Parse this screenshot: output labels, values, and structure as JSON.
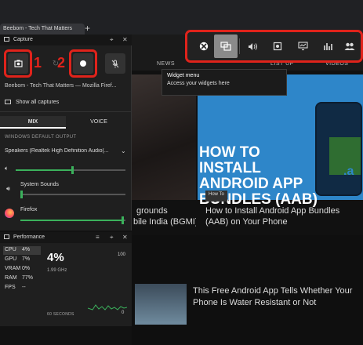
{
  "browser": {
    "tab_title": "Beebom - Tech That Matters",
    "new_tab": "+"
  },
  "website": {
    "nav": [
      "NEWS",
      "LIST UP",
      "VIDEOS"
    ],
    "hero_title": "HOW TO INSTALL ANDROID APP BUNDLES (AAB)",
    "hero_box_text": ".a",
    "chip": "How To",
    "left_article_title": "bile India (BGMI) on PC and Laptop",
    "left_article_title_prefix": "grounds",
    "right_article_title": "How to Install Android App Bundles (AAB) on Your Phone",
    "bottom_article_title": "This Free Android App Tells Whether Your Phone Is Water Resistant or Not"
  },
  "gamebar": {
    "buttons": [
      "xbox-icon",
      "widget-menu-icon",
      "audio-icon",
      "capture-icon",
      "performance-icon",
      "resources-icon",
      "social-icon",
      "settings-icon"
    ]
  },
  "tooltip": {
    "title": "Widget menu",
    "description": "Access your widgets here"
  },
  "capture": {
    "title": "Capture",
    "annotations": [
      "1",
      "2"
    ],
    "source": "Beebom - Tech That Matters — Mozilla Firef...",
    "show_all": "Show all captures",
    "tabs": [
      "MIX",
      "VOICE"
    ],
    "output_label": "WINDOWS DEFAULT OUTPUT",
    "output_device": "Speakers (Realtek High Definition Audio(...",
    "apps": [
      {
        "name": "System Sounds",
        "level": 0.0
      },
      {
        "name": "Firefox",
        "level": 0.98
      }
    ],
    "master_level": 0.52
  },
  "performance": {
    "title": "Performance",
    "rows": [
      {
        "label": "CPU",
        "value": "4%"
      },
      {
        "label": "GPU",
        "value": "7%"
      },
      {
        "label": "VRAM",
        "value": "0%"
      },
      {
        "label": "RAM",
        "value": "77%"
      },
      {
        "label": "FPS",
        "value": "--"
      }
    ],
    "big_value": "4%",
    "clock": "1.99 GHz",
    "scale_max": "100",
    "scale_min": "0",
    "window": "60 SECONDS"
  },
  "colors": {
    "accent_green": "#3bb15c",
    "highlight_red": "#e0231b"
  }
}
